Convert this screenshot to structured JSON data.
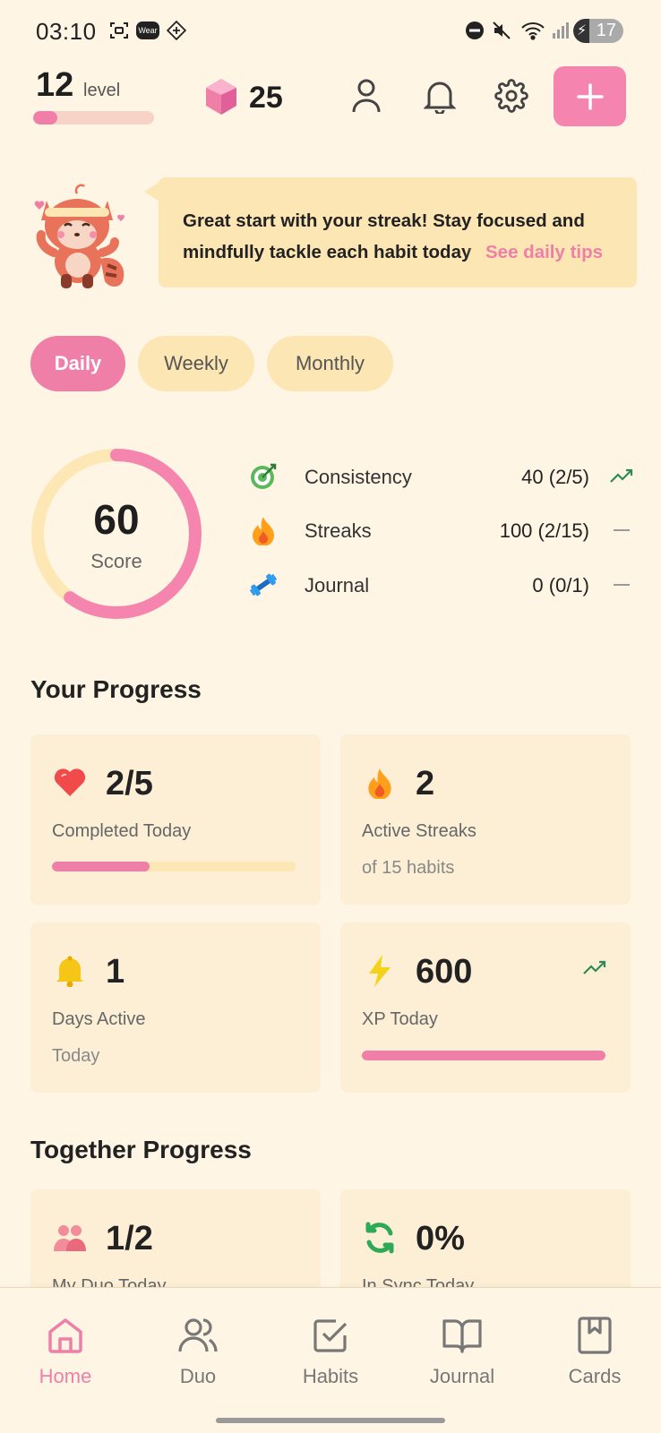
{
  "status_bar": {
    "time": "03:10",
    "wear_label": "Wear",
    "battery": "17"
  },
  "header": {
    "level_number": "12",
    "level_label": "level",
    "level_progress": 0.2,
    "gem_count": "25",
    "icons": [
      "profile-icon",
      "bell-icon",
      "gear-icon",
      "plus-icon"
    ]
  },
  "tip": {
    "line1": "Great start with your streak! Stay focused and",
    "line2": "mindfully tackle each habit today",
    "link": "See daily tips"
  },
  "tabs": [
    {
      "label": "Daily",
      "active": true
    },
    {
      "label": "Weekly",
      "active": false
    },
    {
      "label": "Monthly",
      "active": false
    }
  ],
  "score": {
    "value": "60",
    "label": "Score",
    "fraction": 0.6
  },
  "metrics": [
    {
      "name": "Consistency",
      "value": "40 (2/5)",
      "icon": "target-icon",
      "trend": "up"
    },
    {
      "name": "Streaks",
      "value": "100 (2/15)",
      "icon": "flame-icon",
      "trend": "flat"
    },
    {
      "name": "Journal",
      "value": "0 (0/1)",
      "icon": "dumbbell-icon",
      "trend": "flat"
    }
  ],
  "your_progress": {
    "title": "Your Progress",
    "cards": [
      {
        "value": "2/5",
        "label": "Completed Today",
        "icon": "heart-icon",
        "progress": 0.4
      },
      {
        "value": "2",
        "label": "Active Streaks",
        "sub": "of 15 habits",
        "icon": "flame-icon"
      },
      {
        "value": "1",
        "label": "Days Active",
        "sub": "Today",
        "icon": "bell-icon"
      },
      {
        "value": "600",
        "label": "XP Today",
        "icon": "lightning-icon",
        "progress": 1.0,
        "trend": "up"
      }
    ]
  },
  "together_progress": {
    "title": "Together Progress",
    "cards": [
      {
        "value": "1/2",
        "label": "My Duo Today",
        "icon": "people-icon"
      },
      {
        "value": "0%",
        "label": "In Sync Today",
        "icon": "sync-icon"
      }
    ]
  },
  "nav": [
    {
      "label": "Home",
      "icon": "home-icon",
      "active": true
    },
    {
      "label": "Duo",
      "icon": "duo-icon",
      "active": false
    },
    {
      "label": "Habits",
      "icon": "checkbox-icon",
      "active": false
    },
    {
      "label": "Journal",
      "icon": "book-icon",
      "active": false
    },
    {
      "label": "Cards",
      "icon": "card-icon",
      "active": false
    }
  ],
  "colors": {
    "background": "#FEF5E4",
    "accent_pink": "#F07FA8",
    "button_pink": "#F585AE",
    "card": "#FCEFD6",
    "tab_inactive": "#FCE6B3",
    "ring_track": "#FDE7B4",
    "trend_green": "#2E8B57"
  }
}
